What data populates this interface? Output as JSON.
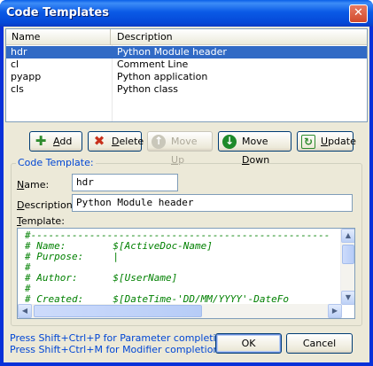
{
  "window": {
    "title": "Code Templates",
    "close_glyph": "✕"
  },
  "list": {
    "columns": [
      "Name",
      "Description"
    ],
    "rows": [
      {
        "name": "hdr",
        "description": "Python Module header",
        "selected": true
      },
      {
        "name": "cl",
        "description": "Comment Line",
        "selected": false
      },
      {
        "name": "pyapp",
        "description": "Python application",
        "selected": false
      },
      {
        "name": "cls",
        "description": "Python class",
        "selected": false
      }
    ]
  },
  "toolbar": {
    "add": {
      "prefix": "",
      "u": "A",
      "rest": "dd",
      "icon": "plus-icon",
      "color": "#2e8b2e"
    },
    "delete": {
      "prefix": "",
      "u": "D",
      "rest": "elete",
      "icon": "x-icon",
      "color": "#c8301c"
    },
    "move_up": {
      "prefix": "Move ",
      "u": "U",
      "rest": "p",
      "icon": "arrow-up-icon",
      "enabled": false
    },
    "move_down": {
      "prefix": "Move ",
      "u": "D",
      "rest": "own",
      "icon": "arrow-down-icon",
      "color": "#1d8a2a"
    },
    "update": {
      "prefix": "",
      "u": "U",
      "rest": "pdate",
      "icon": "refresh-icon",
      "color": "#2e8b2e"
    }
  },
  "form": {
    "group_title": "Code Template:",
    "name_label_u": "N",
    "name_label_rest": "ame:",
    "name_value": "hdr",
    "desc_label_u": "D",
    "desc_label_rest": "escription:",
    "desc_value": "Python Module header",
    "template_label_u": "T",
    "template_label_rest": "emplate:",
    "template_lines": [
      "#---------------------------------------------------",
      "# Name:        $[ActiveDoc-Name]",
      "# Purpose:     |",
      "#",
      "# Author:      $[UserName]",
      "#",
      "# Created:     $[DateTime-'DD/MM/YYYY'-DateFo"
    ]
  },
  "hints": [
    "Press Shift+Ctrl+P for Parameter completion",
    "Press Shift+Ctrl+M for Modifier completion"
  ],
  "buttons": {
    "ok": "OK",
    "cancel": "Cancel"
  }
}
